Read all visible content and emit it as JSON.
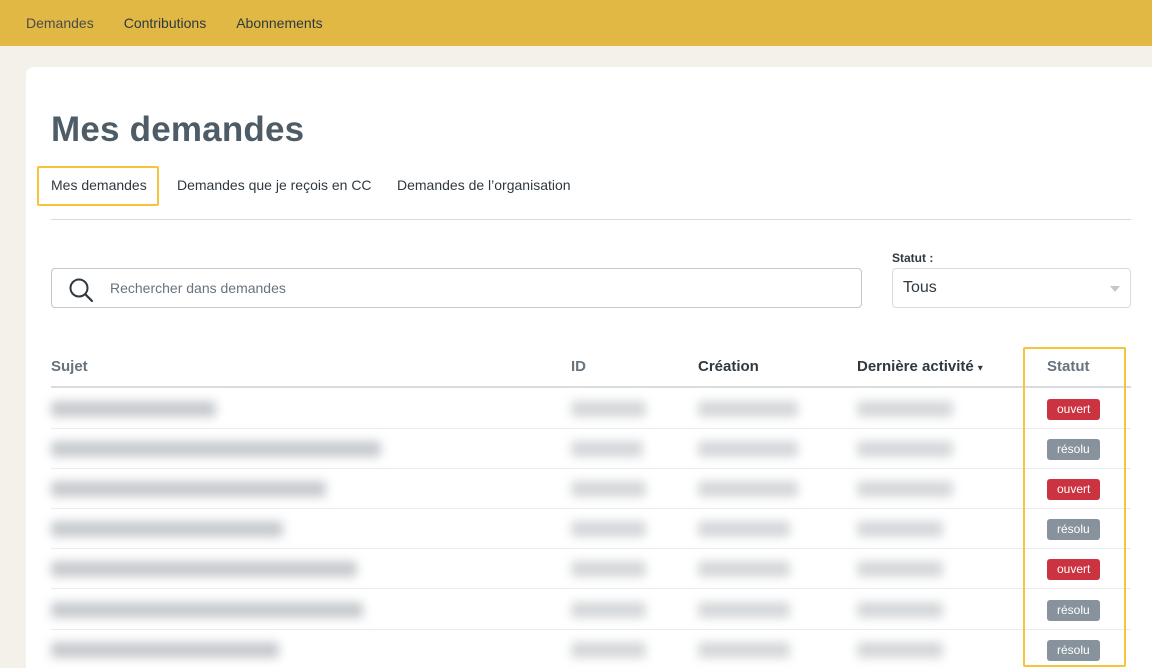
{
  "topnav": {
    "items": [
      {
        "label": "Demandes"
      },
      {
        "label": "Contributions"
      },
      {
        "label": "Abonnements"
      }
    ]
  },
  "page": {
    "title": "Mes demandes"
  },
  "tabs": [
    {
      "label": "Mes demandes"
    },
    {
      "label": "Demandes que je reçois en CC"
    },
    {
      "label": "Demandes de l’organisation"
    }
  ],
  "search": {
    "placeholder": "Rechercher dans demandes"
  },
  "status_filter": {
    "label": "Statut :",
    "value": "Tous"
  },
  "table": {
    "headers": {
      "subject": "Sujet",
      "id": "ID",
      "created": "Création",
      "last_activity": "Dernière activité",
      "sort_indicator": "▾",
      "status": "Statut"
    },
    "rows": [
      {
        "status": "ouvert",
        "status_type": "open"
      },
      {
        "status": "résolu",
        "status_type": "solved"
      },
      {
        "status": "ouvert",
        "status_type": "open"
      },
      {
        "status": "résolu",
        "status_type": "solved"
      },
      {
        "status": "ouvert",
        "status_type": "open"
      },
      {
        "status": "résolu",
        "status_type": "solved"
      },
      {
        "status": "résolu",
        "status_type": "solved"
      }
    ]
  },
  "colors": {
    "topbar": "#e1b844",
    "highlight": "#f5c43a",
    "badge_open": "#cc3340",
    "badge_solved": "#87929d"
  }
}
